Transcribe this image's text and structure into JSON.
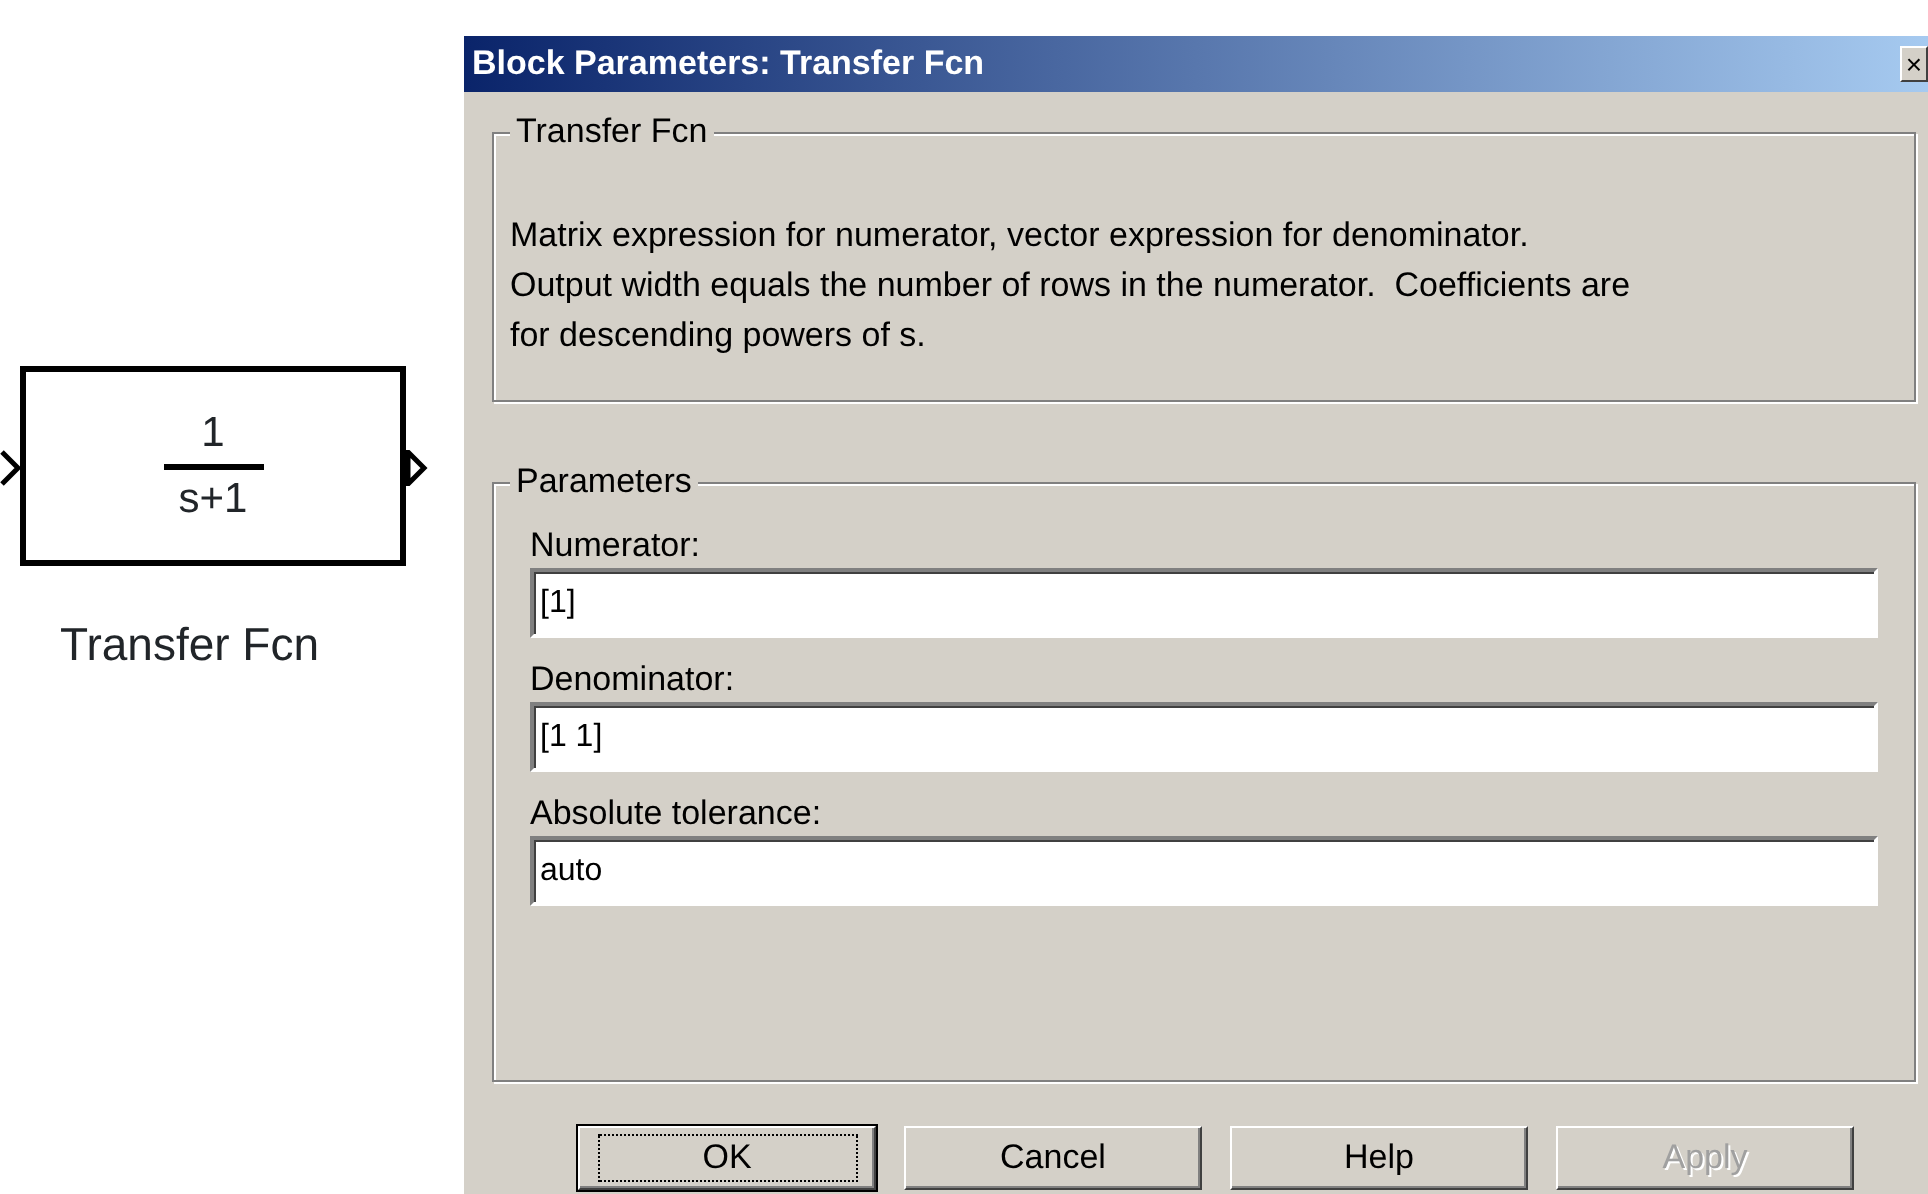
{
  "block": {
    "numerator": "1",
    "denominator": "s+1",
    "label": "Transfer Fcn"
  },
  "dialog": {
    "title": "Block Parameters: Transfer Fcn",
    "close": "×",
    "description_group": {
      "legend": "Transfer Fcn",
      "lines": [
        "Matrix expression for numerator, vector expression for denominator.",
        "Output width equals the number of rows in the numerator.  Coefficients are",
        "for descending powers of s."
      ]
    },
    "parameters_group": {
      "legend": "Parameters",
      "fields": [
        {
          "label": "Numerator:",
          "value": "[1]"
        },
        {
          "label": "Denominator:",
          "value": "[1 1]"
        },
        {
          "label": "Absolute tolerance:",
          "value": "auto"
        }
      ]
    },
    "buttons": [
      {
        "label": "OK",
        "default": true,
        "disabled": false
      },
      {
        "label": "Cancel",
        "default": false,
        "disabled": false
      },
      {
        "label": "Help",
        "default": false,
        "disabled": false
      },
      {
        "label": "Apply",
        "default": false,
        "disabled": true
      }
    ]
  }
}
